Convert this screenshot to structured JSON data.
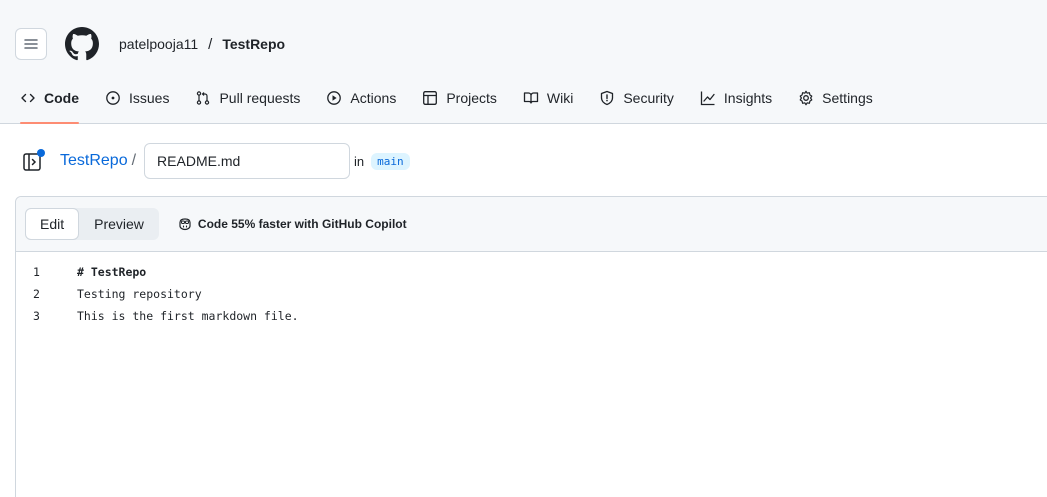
{
  "header": {
    "owner": "patelpooja11",
    "separator": "/",
    "repo": "TestRepo"
  },
  "tabs": [
    {
      "label": "Code",
      "icon": "code-icon",
      "active": true
    },
    {
      "label": "Issues",
      "icon": "issue-icon"
    },
    {
      "label": "Pull requests",
      "icon": "pull-request-icon"
    },
    {
      "label": "Actions",
      "icon": "play-icon"
    },
    {
      "label": "Projects",
      "icon": "table-icon"
    },
    {
      "label": "Wiki",
      "icon": "book-icon"
    },
    {
      "label": "Security",
      "icon": "shield-icon"
    },
    {
      "label": "Insights",
      "icon": "graph-icon"
    },
    {
      "label": "Settings",
      "icon": "gear-icon"
    }
  ],
  "path": {
    "repo": "TestRepo",
    "slash": "/",
    "filename": "README.md",
    "in_text": "in",
    "branch": "main"
  },
  "editor": {
    "edit_label": "Edit",
    "preview_label": "Preview",
    "copilot_text": "Code 55% faster with GitHub Copilot",
    "lines": [
      {
        "num": "1",
        "text": "# TestRepo"
      },
      {
        "num": "2",
        "text": "Testing repository"
      },
      {
        "num": "3",
        "text": "This is the first markdown file."
      }
    ]
  },
  "colors": {
    "accent_link": "#0969da",
    "tab_underline": "#fd8c73",
    "border": "#d0d7de",
    "header_bg": "#f6f8fa"
  }
}
